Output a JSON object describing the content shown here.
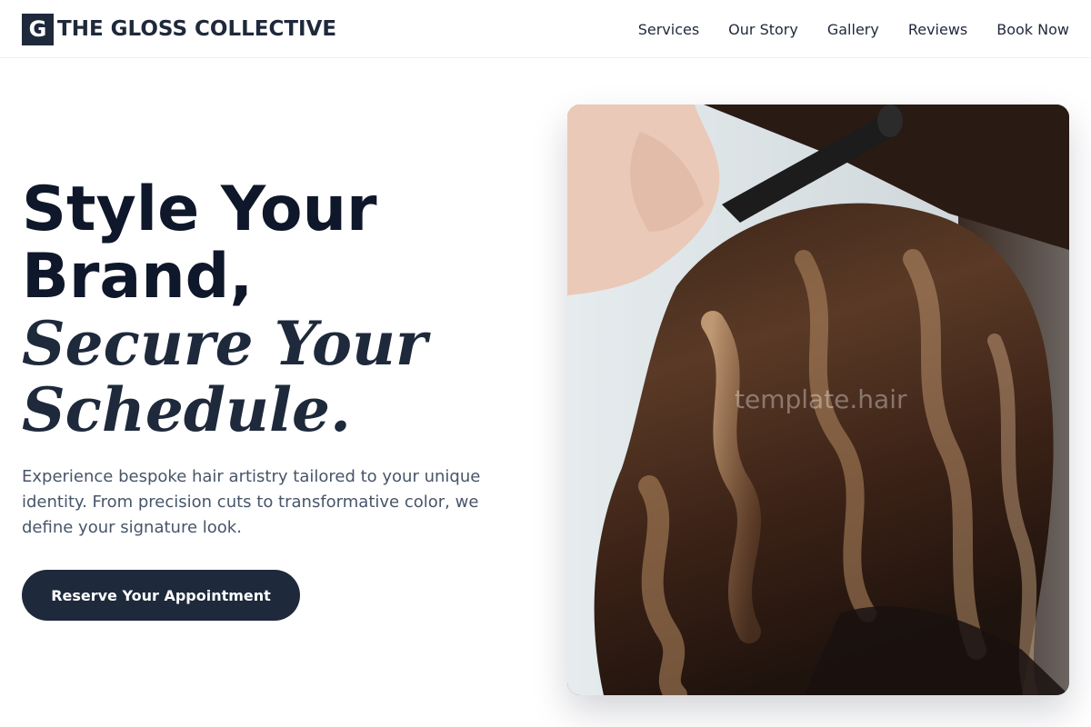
{
  "brand": {
    "mark": "G",
    "name": "THE GLOSS COLLECTIVE"
  },
  "nav": {
    "items": [
      {
        "label": "Services"
      },
      {
        "label": "Our Story"
      },
      {
        "label": "Gallery"
      },
      {
        "label": "Reviews"
      },
      {
        "label": "Book Now"
      }
    ]
  },
  "hero": {
    "title_line1": "Style Your",
    "title_line2": "Brand,",
    "italic_line1": "Secure Your",
    "italic_line2": "Schedule.",
    "description": "Experience bespoke hair artistry tailored to your unique identity. From precision cuts to transformative color, we define your signature look.",
    "cta_label": "Reserve Your Appointment",
    "image_watermark": "template.hair"
  },
  "colors": {
    "primary": "#1e293b",
    "heading": "#0f172a",
    "body_text": "#475569",
    "background": "#ffffff"
  }
}
